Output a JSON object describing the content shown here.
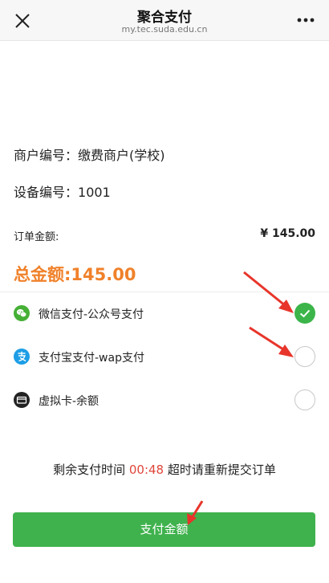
{
  "nav": {
    "title": "聚合支付",
    "subtitle": "my.tec.suda.edu.cn"
  },
  "merchant": {
    "label": "商户编号：",
    "value": "缴费商户(学校)"
  },
  "device": {
    "label": "设备编号：",
    "value": "1001"
  },
  "order": {
    "label": "订单金额:",
    "amount": "¥ 145.00"
  },
  "total": {
    "text": "总金额:145.00"
  },
  "payment_methods": [
    {
      "label": "微信支付-公众号支付",
      "icon": "wechat-icon",
      "selected": true
    },
    {
      "label": "支付宝支付-wap支付",
      "icon": "alipay-icon",
      "selected": false
    },
    {
      "label": "虚拟卡-余额",
      "icon": "card-icon",
      "selected": false
    }
  ],
  "timer": {
    "prefix": "剩余支付时间",
    "countdown": "00:48",
    "suffix": "超时请重新提交订单"
  },
  "pay_button": {
    "label": "支付金额"
  },
  "colors": {
    "accent_green": "#3fb24d",
    "total_orange": "#f0812a",
    "countdown_red": "#e0463b",
    "annotation_red": "#e8352b"
  }
}
